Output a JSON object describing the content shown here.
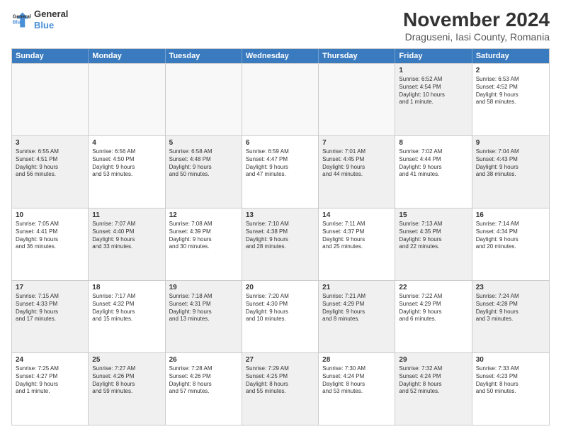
{
  "logo": {
    "line1": "General",
    "line2": "Blue"
  },
  "title": "November 2024",
  "subtitle": "Draguseni, Iasi County, Romania",
  "days": [
    "Sunday",
    "Monday",
    "Tuesday",
    "Wednesday",
    "Thursday",
    "Friday",
    "Saturday"
  ],
  "rows": [
    [
      {
        "day": "",
        "detail": "",
        "empty": true
      },
      {
        "day": "",
        "detail": "",
        "empty": true
      },
      {
        "day": "",
        "detail": "",
        "empty": true
      },
      {
        "day": "",
        "detail": "",
        "empty": true
      },
      {
        "day": "",
        "detail": "",
        "empty": true
      },
      {
        "day": "1",
        "detail": "Sunrise: 6:52 AM\nSunset: 4:54 PM\nDaylight: 10 hours\nand 1 minute.",
        "shaded": true
      },
      {
        "day": "2",
        "detail": "Sunrise: 6:53 AM\nSunset: 4:52 PM\nDaylight: 9 hours\nand 58 minutes.",
        "shaded": false
      }
    ],
    [
      {
        "day": "3",
        "detail": "Sunrise: 6:55 AM\nSunset: 4:51 PM\nDaylight: 9 hours\nand 56 minutes.",
        "shaded": true
      },
      {
        "day": "4",
        "detail": "Sunrise: 6:56 AM\nSunset: 4:50 PM\nDaylight: 9 hours\nand 53 minutes.",
        "shaded": false
      },
      {
        "day": "5",
        "detail": "Sunrise: 6:58 AM\nSunset: 4:48 PM\nDaylight: 9 hours\nand 50 minutes.",
        "shaded": true
      },
      {
        "day": "6",
        "detail": "Sunrise: 6:59 AM\nSunset: 4:47 PM\nDaylight: 9 hours\nand 47 minutes.",
        "shaded": false
      },
      {
        "day": "7",
        "detail": "Sunrise: 7:01 AM\nSunset: 4:45 PM\nDaylight: 9 hours\nand 44 minutes.",
        "shaded": true
      },
      {
        "day": "8",
        "detail": "Sunrise: 7:02 AM\nSunset: 4:44 PM\nDaylight: 9 hours\nand 41 minutes.",
        "shaded": false
      },
      {
        "day": "9",
        "detail": "Sunrise: 7:04 AM\nSunset: 4:43 PM\nDaylight: 9 hours\nand 38 minutes.",
        "shaded": true
      }
    ],
    [
      {
        "day": "10",
        "detail": "Sunrise: 7:05 AM\nSunset: 4:41 PM\nDaylight: 9 hours\nand 36 minutes.",
        "shaded": false
      },
      {
        "day": "11",
        "detail": "Sunrise: 7:07 AM\nSunset: 4:40 PM\nDaylight: 9 hours\nand 33 minutes.",
        "shaded": true
      },
      {
        "day": "12",
        "detail": "Sunrise: 7:08 AM\nSunset: 4:39 PM\nDaylight: 9 hours\nand 30 minutes.",
        "shaded": false
      },
      {
        "day": "13",
        "detail": "Sunrise: 7:10 AM\nSunset: 4:38 PM\nDaylight: 9 hours\nand 28 minutes.",
        "shaded": true
      },
      {
        "day": "14",
        "detail": "Sunrise: 7:11 AM\nSunset: 4:37 PM\nDaylight: 9 hours\nand 25 minutes.",
        "shaded": false
      },
      {
        "day": "15",
        "detail": "Sunrise: 7:13 AM\nSunset: 4:35 PM\nDaylight: 9 hours\nand 22 minutes.",
        "shaded": true
      },
      {
        "day": "16",
        "detail": "Sunrise: 7:14 AM\nSunset: 4:34 PM\nDaylight: 9 hours\nand 20 minutes.",
        "shaded": false
      }
    ],
    [
      {
        "day": "17",
        "detail": "Sunrise: 7:15 AM\nSunset: 4:33 PM\nDaylight: 9 hours\nand 17 minutes.",
        "shaded": true
      },
      {
        "day": "18",
        "detail": "Sunrise: 7:17 AM\nSunset: 4:32 PM\nDaylight: 9 hours\nand 15 minutes.",
        "shaded": false
      },
      {
        "day": "19",
        "detail": "Sunrise: 7:18 AM\nSunset: 4:31 PM\nDaylight: 9 hours\nand 13 minutes.",
        "shaded": true
      },
      {
        "day": "20",
        "detail": "Sunrise: 7:20 AM\nSunset: 4:30 PM\nDaylight: 9 hours\nand 10 minutes.",
        "shaded": false
      },
      {
        "day": "21",
        "detail": "Sunrise: 7:21 AM\nSunset: 4:29 PM\nDaylight: 9 hours\nand 8 minutes.",
        "shaded": true
      },
      {
        "day": "22",
        "detail": "Sunrise: 7:22 AM\nSunset: 4:29 PM\nDaylight: 9 hours\nand 6 minutes.",
        "shaded": false
      },
      {
        "day": "23",
        "detail": "Sunrise: 7:24 AM\nSunset: 4:28 PM\nDaylight: 9 hours\nand 3 minutes.",
        "shaded": true
      }
    ],
    [
      {
        "day": "24",
        "detail": "Sunrise: 7:25 AM\nSunset: 4:27 PM\nDaylight: 9 hours\nand 1 minute.",
        "shaded": false
      },
      {
        "day": "25",
        "detail": "Sunrise: 7:27 AM\nSunset: 4:26 PM\nDaylight: 8 hours\nand 59 minutes.",
        "shaded": true
      },
      {
        "day": "26",
        "detail": "Sunrise: 7:28 AM\nSunset: 4:26 PM\nDaylight: 8 hours\nand 57 minutes.",
        "shaded": false
      },
      {
        "day": "27",
        "detail": "Sunrise: 7:29 AM\nSunset: 4:25 PM\nDaylight: 8 hours\nand 55 minutes.",
        "shaded": true
      },
      {
        "day": "28",
        "detail": "Sunrise: 7:30 AM\nSunset: 4:24 PM\nDaylight: 8 hours\nand 53 minutes.",
        "shaded": false
      },
      {
        "day": "29",
        "detail": "Sunrise: 7:32 AM\nSunset: 4:24 PM\nDaylight: 8 hours\nand 52 minutes.",
        "shaded": true
      },
      {
        "day": "30",
        "detail": "Sunrise: 7:33 AM\nSunset: 4:23 PM\nDaylight: 8 hours\nand 50 minutes.",
        "shaded": false
      }
    ]
  ]
}
